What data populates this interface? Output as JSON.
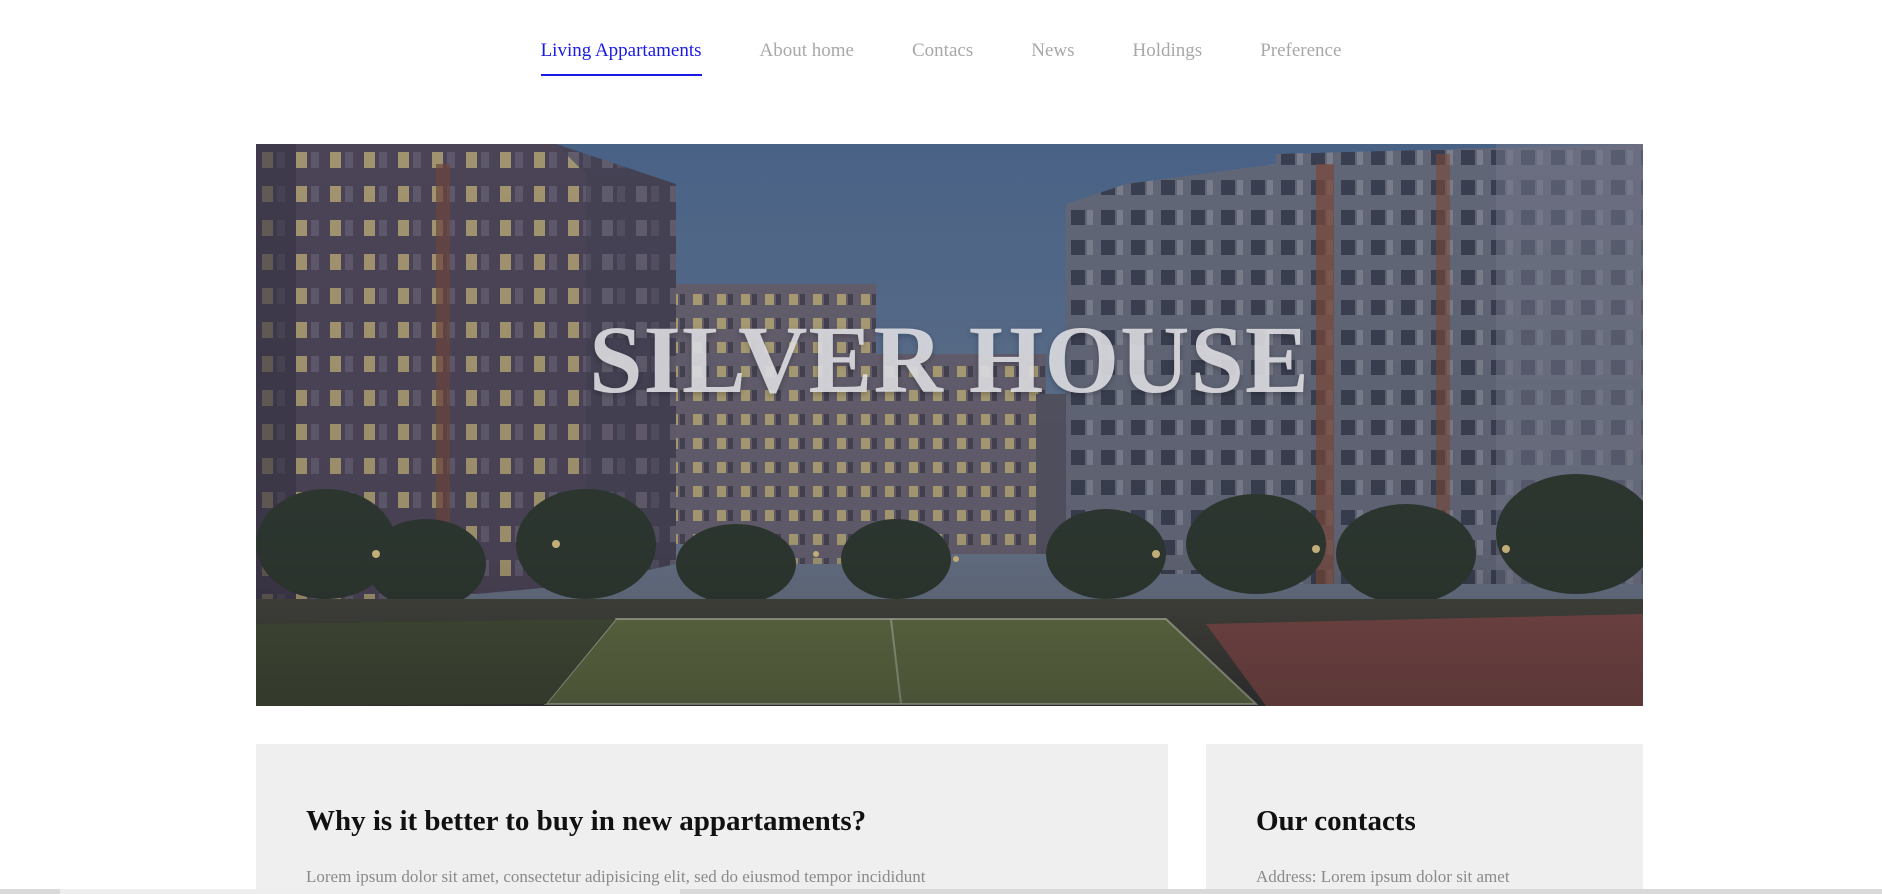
{
  "nav": {
    "items": [
      {
        "label": "Living Appartaments",
        "active": true
      },
      {
        "label": "About home",
        "active": false
      },
      {
        "label": "Contacs",
        "active": false
      },
      {
        "label": "News",
        "active": false
      },
      {
        "label": "Holdings",
        "active": false
      },
      {
        "label": "Preference",
        "active": false
      }
    ],
    "active_color": "#1a1ae6",
    "inactive_color": "#a8a8a8"
  },
  "hero": {
    "title": "SILVER HOUSE",
    "image": "apartment-complex-night-courtyard"
  },
  "cards": {
    "main": {
      "title": "Why is it better to buy in new appartaments?",
      "text": "Lorem ipsum dolor sit amet, consectetur adipisicing elit, sed do eiusmod tempor incididunt"
    },
    "side": {
      "title": "Our contacts",
      "text": "Address: Lorem ipsum dolor sit amet"
    }
  }
}
